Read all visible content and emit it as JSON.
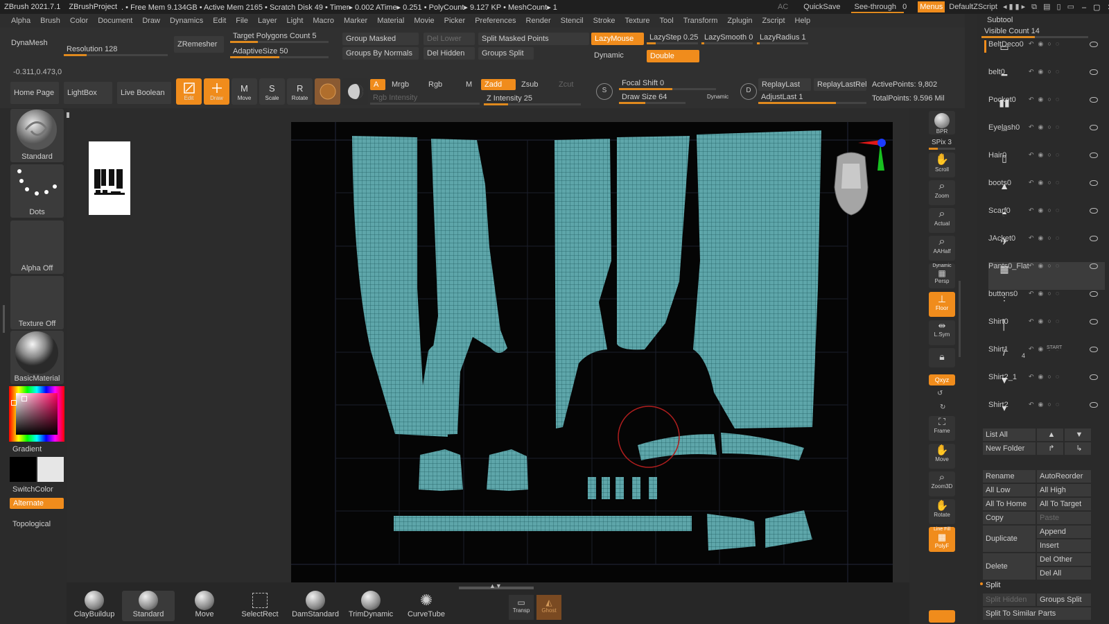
{
  "titlebar": {
    "app": "ZBrush 2021.7.1",
    "project": "ZBrushProject",
    "stats": ". • Free Mem 9.134GB • Active Mem 2165 • Scratch Disk 49 •  Timer▸ 0.002 ATime▸ 0.251 • PolyCount▸ 9.127 KP  • MeshCount▸ 1",
    "ac": "AC",
    "quicksave": "QuickSave",
    "seethrough": "See-through",
    "seethrough_value": "0",
    "menus": "Menus",
    "defaultzscript": "DefaultZScript"
  },
  "menu": [
    "Alpha",
    "Brush",
    "Color",
    "Document",
    "Draw",
    "Dynamics",
    "Edit",
    "File",
    "Layer",
    "Light",
    "Macro",
    "Marker",
    "Material",
    "Movie",
    "Picker",
    "Preferences",
    "Render",
    "Stencil",
    "Stroke",
    "Texture",
    "Tool",
    "Transform",
    "Zplugin",
    "Zscript",
    "Help"
  ],
  "topshelf": {
    "dynamesh": "DynaMesh",
    "resolution": "Resolution 128",
    "zremesher": "ZRemesher",
    "target_polygons": "Target Polygons Count 5",
    "adaptive_size": "AdaptiveSize 50",
    "group_masked": "Group Masked",
    "groups_by_normals": "Groups By Normals",
    "del_lower": "Del Lower",
    "del_hidden": "Del Hidden",
    "split_masked": "Split Masked Points",
    "groups_split": "Groups Split",
    "lazymouse": "LazyMouse",
    "lazystep": "LazyStep 0.25",
    "lazysmooth": "LazySmooth 0",
    "lazyradius": "LazyRadius 1",
    "dynamic": "Dynamic",
    "double": "Double",
    "coords": "-0.311,0.473,0",
    "home_page": "Home Page",
    "lightbox": "LightBox",
    "live_boolean": "Live Boolean",
    "edit": "Edit",
    "draw": "Draw",
    "move": "Move",
    "scale": "Scale",
    "rotate": "Rotate",
    "a": "A",
    "mrgb": "Mrgb",
    "rgb": "Rgb",
    "m": "M",
    "rgb_intensity": "Rgb Intensity",
    "zadd": "Zadd",
    "zsub": "Zsub",
    "zcut": "Zcut",
    "z_intensity": "Z Intensity 25",
    "focal_shift": "Focal Shift 0",
    "draw_size": "Draw Size 64",
    "dynamic_small": "Dynamic",
    "replaylast": "ReplayLast",
    "replaylastrel": "ReplayLastRel",
    "adjustlast": "AdjustLast 1",
    "activepoints": "ActivePoints: 9,802",
    "totalpoints": "TotalPoints: 9.596 Mil"
  },
  "leftshelf": {
    "standard": "Standard",
    "dots": "Dots",
    "alpha_off": "Alpha Off",
    "texture_off": "Texture Off",
    "basicmaterial": "BasicMaterial",
    "gradient": "Gradient",
    "switchcolor": "SwitchColor",
    "alternate": "Alternate",
    "topological": "Topological"
  },
  "rightshelf": {
    "bpr": "BPR",
    "spix": "SPix 3",
    "scroll": "Scroll",
    "zoom": "Zoom",
    "actual": "Actual",
    "aahalf": "AAHalf",
    "persp": "Persp",
    "dynamic": "Dynamic",
    "floor": "Floor",
    "lsym": "L.Sym",
    "xyz": "Qxyz",
    "frame": "Frame",
    "move": "Move",
    "zoom3d": "Zoom3D",
    "rotate": "Rotate",
    "polyf": "PolyF",
    "linefill": "Line Fill"
  },
  "bottombar": {
    "brushes": [
      "ClayBuildup",
      "Standard",
      "Move",
      "SelectRect",
      "DamStandard",
      "TrimDynamic",
      "CurveTube"
    ],
    "transp": "Transp",
    "ghost": "Ghost"
  },
  "subtool": {
    "title": "Subtool",
    "visible_count": "Visible Count 14",
    "items": [
      "BeltDeco0",
      "belt0",
      "Pocket0",
      "Eyelash0",
      "Hair0",
      "boots0",
      "Scarf0",
      "JAcket0",
      "Pants0_Flat",
      "buttons0",
      "Shirt0",
      "Shirt1",
      "Shirt2_1",
      "Shirt2"
    ],
    "start": "START",
    "start_num": "4",
    "list_all": "List All",
    "new_folder": "New Folder",
    "rename": "Rename",
    "autoreorder": "AutoReorder",
    "all_low": "All Low",
    "all_high": "All High",
    "all_to_home": "All To Home",
    "all_to_target": "All To Target",
    "copy": "Copy",
    "paste": "Paste",
    "duplicate": "Duplicate",
    "append": "Append",
    "insert": "Insert",
    "delete": "Delete",
    "del_other": "Del Other",
    "del_all": "Del All",
    "split": "Split",
    "split_hidden": "Split Hidden",
    "groups_split": "Groups Split",
    "split_similar": "Split To Similar Parts"
  },
  "colors": {
    "accent": "#f08c1c",
    "uv": "#5ea6aa",
    "bg": "#2b2b2b"
  }
}
